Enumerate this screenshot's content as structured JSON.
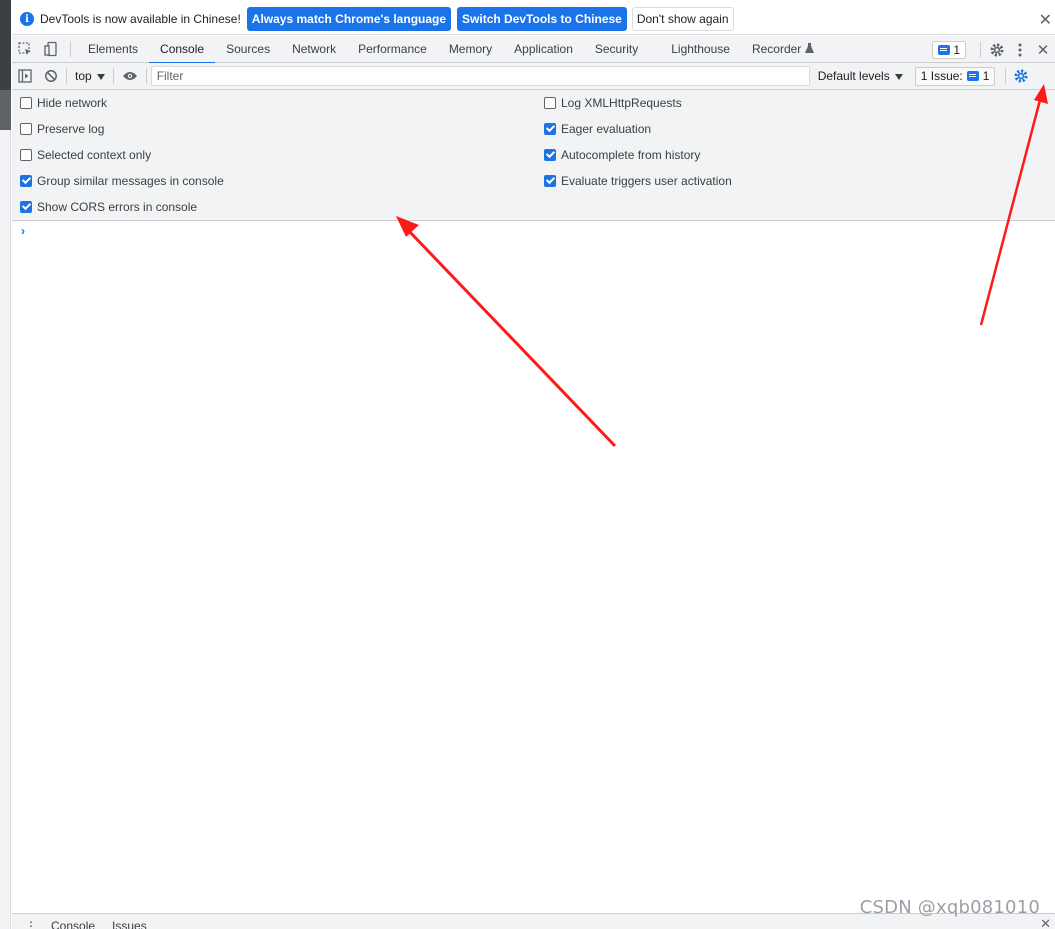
{
  "infobar": {
    "message": "DevTools is now available in Chinese!",
    "match_button": "Always match Chrome's language",
    "switch_button": "Switch DevTools to Chinese",
    "dismiss_button": "Don't show again",
    "close_glyph": "✕"
  },
  "tabs": [
    {
      "label": "Elements"
    },
    {
      "label": "Console"
    },
    {
      "label": "Sources"
    },
    {
      "label": "Network"
    },
    {
      "label": "Performance"
    },
    {
      "label": "Memory"
    },
    {
      "label": "Application"
    },
    {
      "label": "Security"
    },
    {
      "label": "Lighthouse"
    },
    {
      "label": "Recorder"
    }
  ],
  "active_tab": "Console",
  "tabbar_right": {
    "issues_badge_count": "1",
    "close_glyph": "✕"
  },
  "console_toolbar": {
    "context": "top",
    "filter_placeholder": "Filter",
    "levels": "Default levels",
    "issues_label": "1 Issue:",
    "issues_count": "1"
  },
  "settings": {
    "left": [
      {
        "label": "Hide network",
        "checked": false
      },
      {
        "label": "Preserve log",
        "checked": false
      },
      {
        "label": "Selected context only",
        "checked": false
      },
      {
        "label": "Group similar messages in console",
        "checked": true
      },
      {
        "label": "Show CORS errors in console",
        "checked": true
      }
    ],
    "right": [
      {
        "label": "Log XMLHttpRequests",
        "checked": false
      },
      {
        "label": "Eager evaluation",
        "checked": true
      },
      {
        "label": "Autocomplete from history",
        "checked": true
      },
      {
        "label": "Evaluate triggers user activation",
        "checked": true
      }
    ]
  },
  "console": {
    "prompt": "›"
  },
  "drawer": {
    "tabs": [
      "Console",
      "Issues"
    ],
    "close_glyph": "✕"
  },
  "watermark": "CSDN @xqb081010",
  "colors": {
    "accent": "#1a73e8",
    "annotation_arrow": "#ff1a1a",
    "toolbar_bg": "#f1f3f4"
  },
  "icons": [
    "info-icon",
    "inspect-element-icon",
    "device-toolbar-icon",
    "recorder-flask-icon",
    "settings-gear-icon",
    "more-vertical-icon",
    "sidebar-toggle-icon",
    "clear-console-icon",
    "eye-icon",
    "console-settings-gear-icon",
    "dropdown-caret-icon"
  ]
}
